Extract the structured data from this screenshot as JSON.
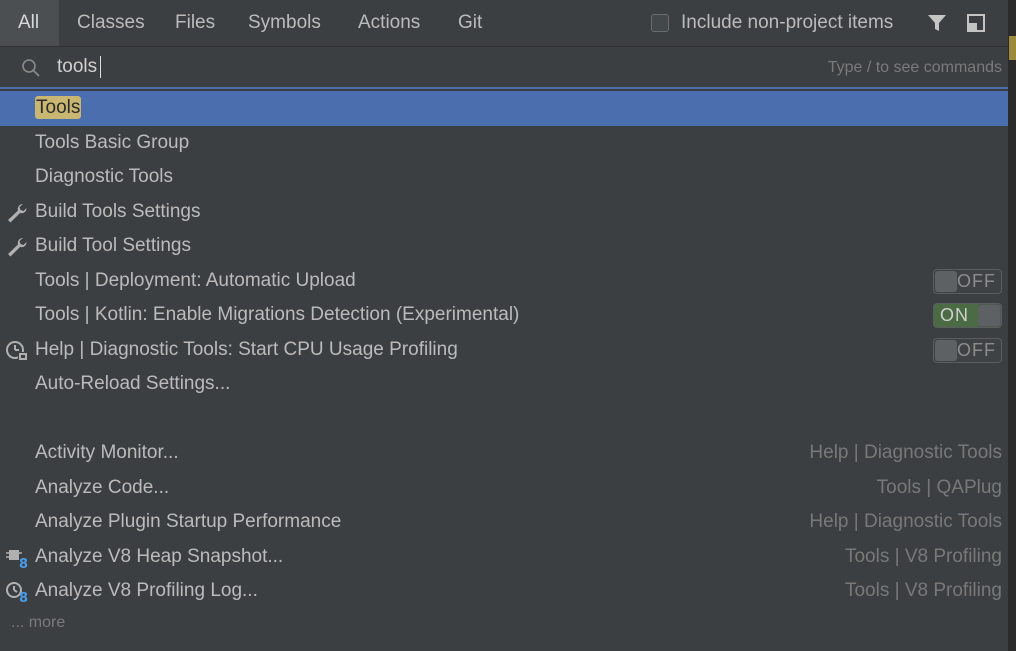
{
  "tabs": [
    {
      "label": "All",
      "active": true
    },
    {
      "label": "Classes"
    },
    {
      "label": "Files"
    },
    {
      "label": "Symbols"
    },
    {
      "label": "Actions"
    },
    {
      "label": "Git"
    }
  ],
  "include_non_project": {
    "label": "Include non-project items",
    "checked": false
  },
  "toolbar_icons": [
    "filter-icon",
    "preview-panel-icon"
  ],
  "search": {
    "query": "tools",
    "hint": "Type / to see commands"
  },
  "results": [
    {
      "pre": "",
      "match": "Tools",
      "post": "",
      "selected": true
    },
    {
      "label": "Tools Basic Group"
    },
    {
      "label": "Diagnostic Tools"
    },
    {
      "label": "Build Tools Settings",
      "icon": "wrench-icon"
    },
    {
      "label": "Build Tool Settings",
      "icon": "wrench-icon"
    },
    {
      "label": "Tools | Deployment: Automatic Upload",
      "toggle": "OFF"
    },
    {
      "label": "Tools | Kotlin: Enable Migrations Detection (Experimental)",
      "toggle": "ON"
    },
    {
      "label": "Help | Diagnostic Tools: Start CPU Usage Profiling",
      "icon": "cpu-profiling-icon",
      "toggle": "OFF"
    },
    {
      "label": "Auto-Reload Settings..."
    },
    {
      "label": "Activity Monitor...",
      "hint": "Help | Diagnostic Tools"
    },
    {
      "label": "Analyze Code...",
      "hint": "Tools | QAPlug"
    },
    {
      "label": "Analyze Plugin Startup Performance",
      "hint": "Help | Diagnostic Tools"
    },
    {
      "label": "Analyze V8 Heap Snapshot...",
      "icon": "v8-heap-icon",
      "hint": "Tools | V8 Profiling"
    },
    {
      "label": "Analyze V8 Profiling Log...",
      "icon": "v8-profiling-icon",
      "hint": "Tools | V8 Profiling"
    }
  ],
  "more_label": "... more",
  "colors": {
    "selection": "#4b6eaf",
    "match_highlight": "#c9b670",
    "background": "#3c3f41"
  }
}
